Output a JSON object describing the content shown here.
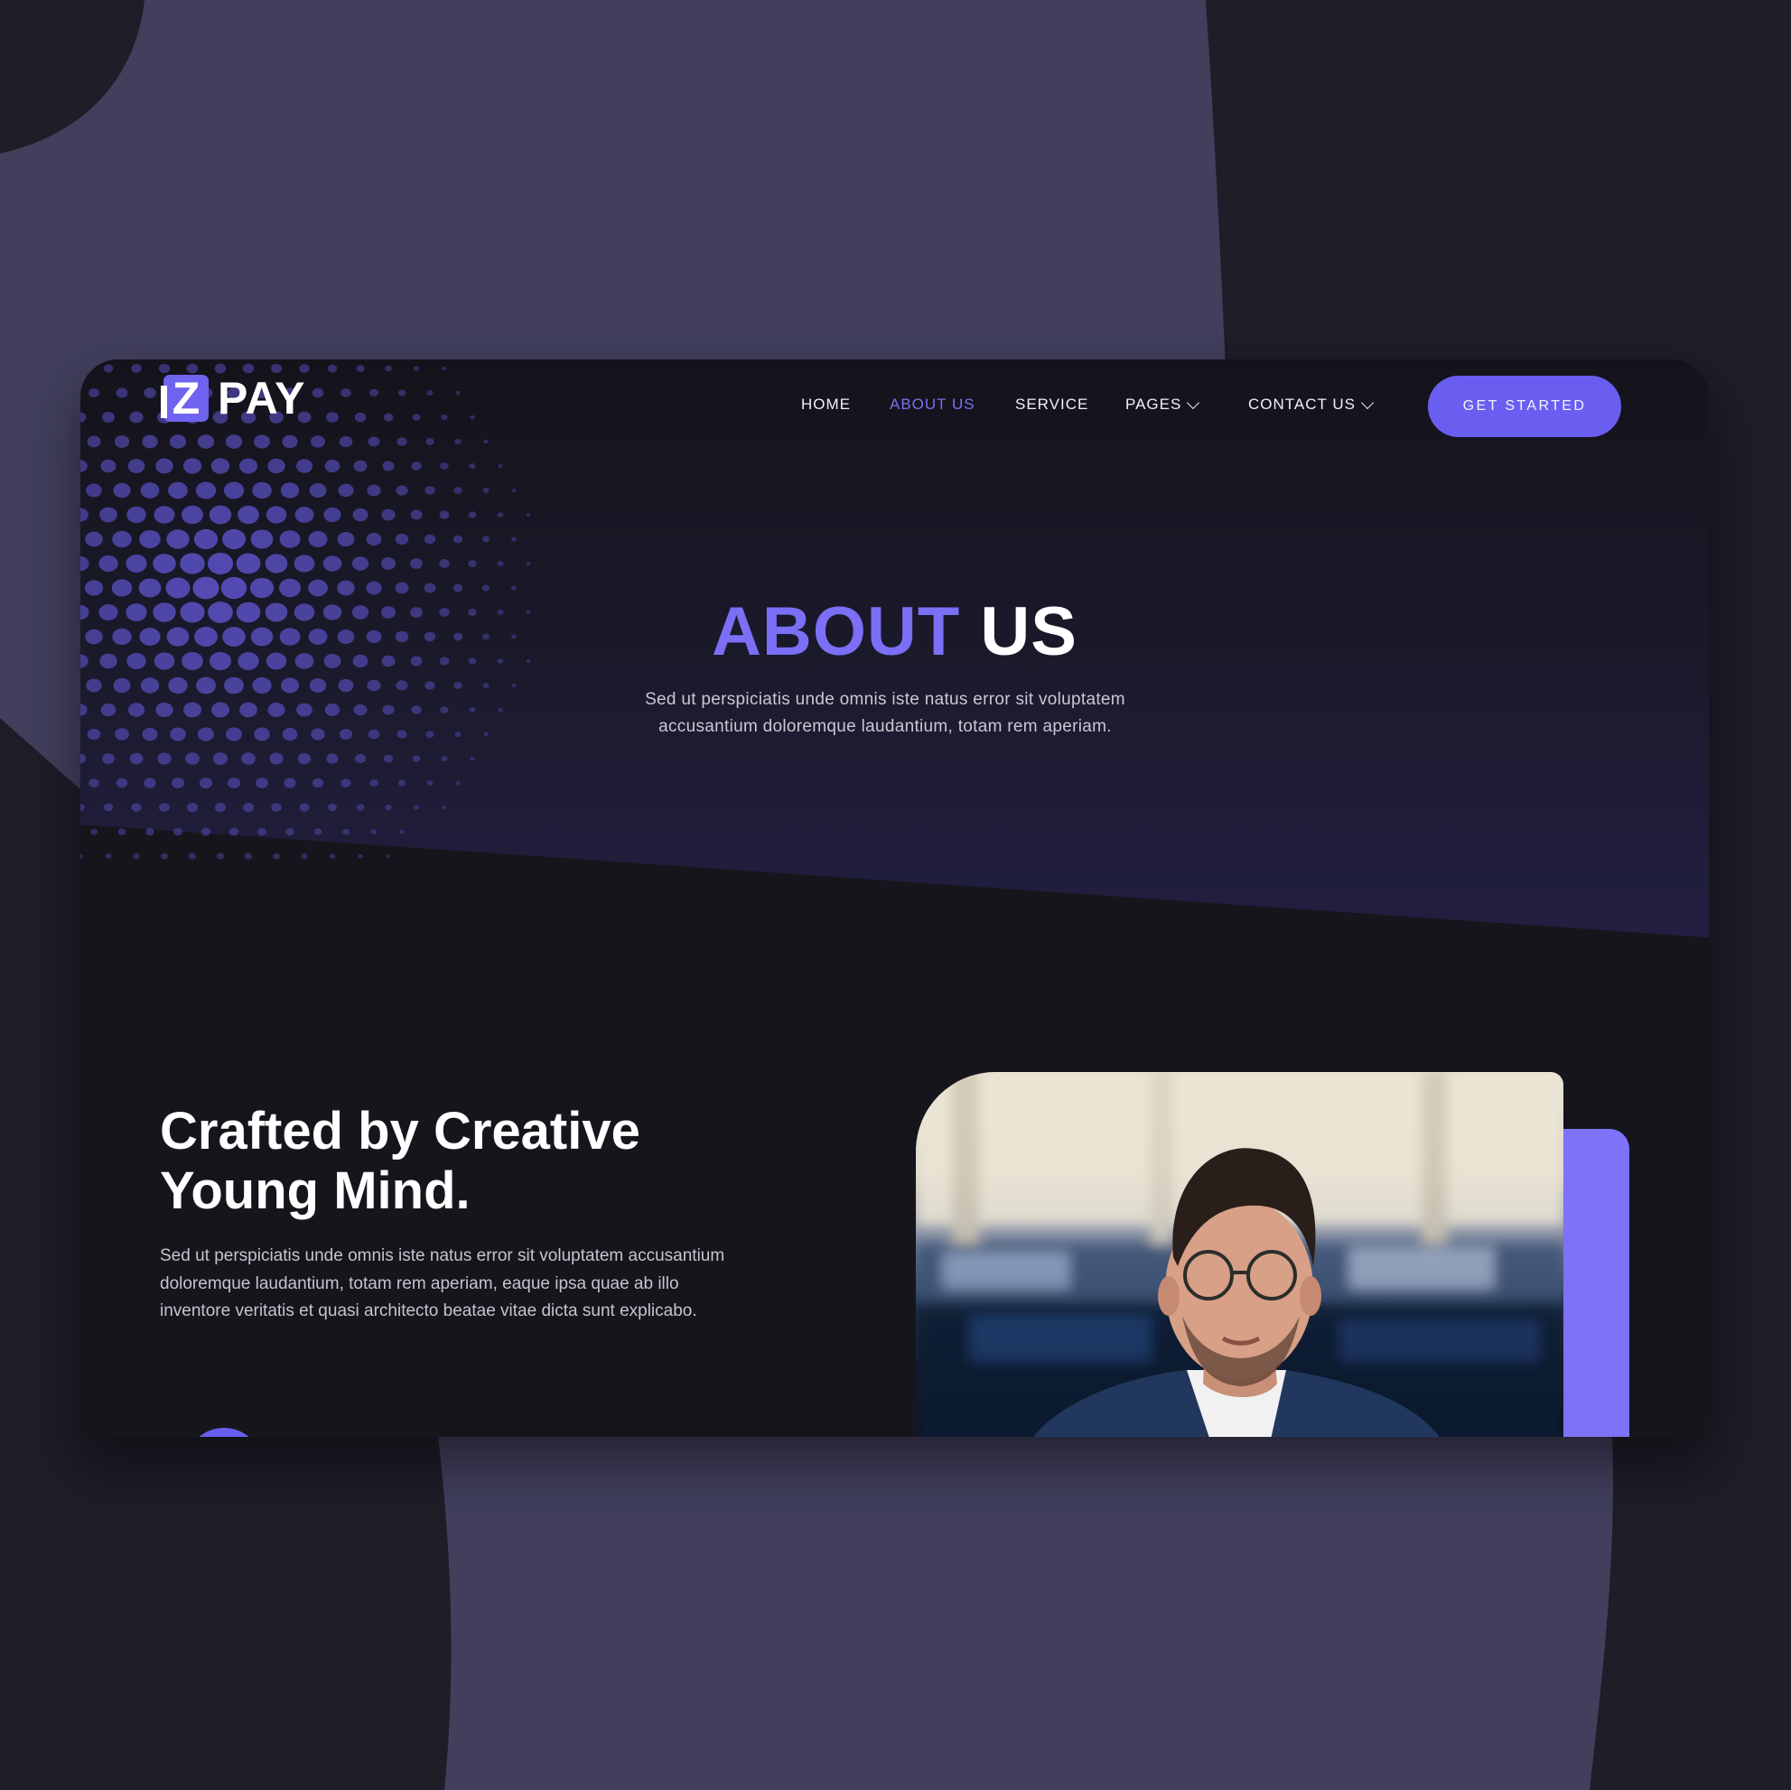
{
  "brand": {
    "logo_mark": "Z",
    "logo_text": "PAY"
  },
  "nav": {
    "items": [
      {
        "label": "HOME",
        "active": false,
        "dropdown": false
      },
      {
        "label": "ABOUT US",
        "active": true,
        "dropdown": false
      },
      {
        "label": "SERVICE",
        "active": false,
        "dropdown": false
      },
      {
        "label": "PAGES",
        "active": false,
        "dropdown": true
      },
      {
        "label": "CONTACT US",
        "active": false,
        "dropdown": true
      }
    ],
    "cta_label": "GET STARTED"
  },
  "hero": {
    "title_accent": "ABOUT",
    "title_plain": "US",
    "subtitle": "Sed ut perspiciatis unde omnis iste natus error sit voluptatem accusantium doloremque laudantium, totam rem aperiam."
  },
  "about": {
    "heading": "Crafted by Creative Young Mind.",
    "body": "Sed ut perspiciatis unde omnis iste natus error sit voluptatem accusantium doloremque laudantium, totam rem aperiam, eaque ipsa quae ab illo inventore veritatis et quasi architecto beatae vitae dicta sunt explicabo."
  },
  "colors": {
    "accent": "#7b6ff5",
    "button": "#6a5ef0",
    "backdrop": "#1e1d28",
    "backdrop_shape": "#413f5c",
    "card": "#16151c"
  },
  "icons": {
    "dropdown": "chevron-down-icon"
  }
}
